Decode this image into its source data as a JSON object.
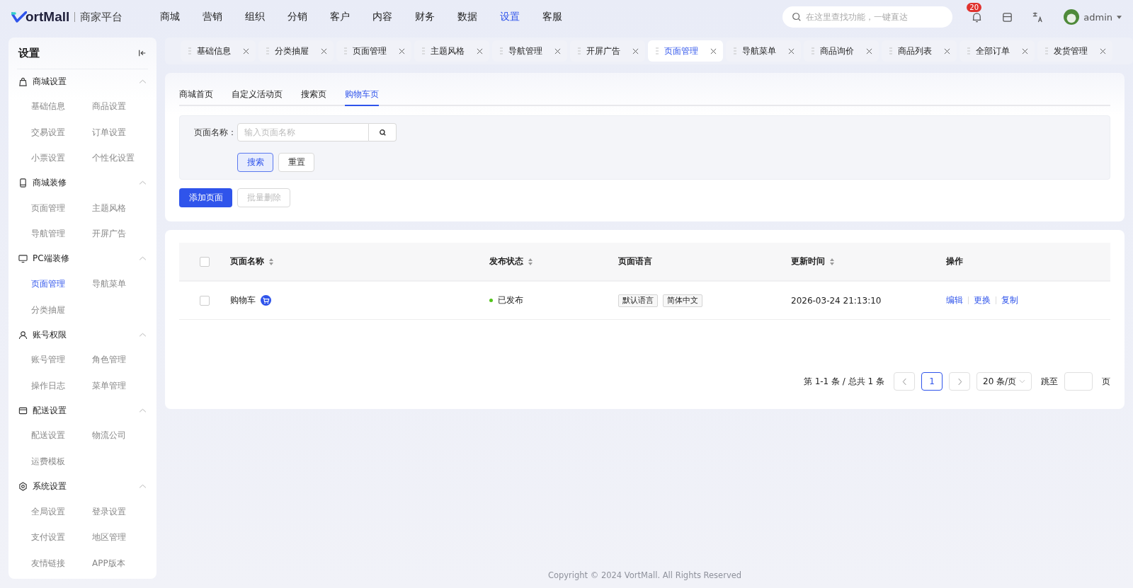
{
  "header": {
    "logo_text": "ortMall",
    "platform": "商家平台",
    "nav": [
      {
        "label": "商城",
        "selected": false
      },
      {
        "label": "营销",
        "selected": false
      },
      {
        "label": "组织",
        "selected": false
      },
      {
        "label": "分销",
        "selected": false
      },
      {
        "label": "客户",
        "selected": false
      },
      {
        "label": "内容",
        "selected": false
      },
      {
        "label": "财务",
        "selected": false
      },
      {
        "label": "数据",
        "selected": false
      },
      {
        "label": "设置",
        "selected": true
      },
      {
        "label": "客服",
        "selected": false
      }
    ],
    "search": {
      "placeholder": "在这里查找功能，一键直达"
    },
    "notification_count": "20",
    "user": "admin"
  },
  "sidebar": {
    "title": "设置",
    "groups": [
      {
        "title": "商城设置",
        "kind": "bag",
        "expanded": true,
        "items": [
          {
            "label": "基础信息",
            "selected": false
          },
          {
            "label": "商品设置",
            "selected": false
          },
          {
            "label": "交易设置",
            "selected": false
          },
          {
            "label": "订单设置",
            "selected": false
          },
          {
            "label": "小票设置",
            "selected": false
          },
          {
            "label": "个性化设置",
            "selected": false
          }
        ]
      },
      {
        "title": "商城装修",
        "kind": "phone",
        "expanded": true,
        "items": [
          {
            "label": "页面管理",
            "selected": false
          },
          {
            "label": "主题风格",
            "selected": false
          },
          {
            "label": "导航管理",
            "selected": false
          },
          {
            "label": "开屏广告",
            "selected": false
          }
        ]
      },
      {
        "title": "PC端装修",
        "kind": "monitor",
        "expanded": true,
        "items": [
          {
            "label": "页面管理",
            "selected": true
          },
          {
            "label": "导航菜单",
            "selected": false
          },
          {
            "label": "分类抽屉",
            "selected": false
          }
        ]
      },
      {
        "title": "账号权限",
        "kind": "user",
        "expanded": true,
        "items": [
          {
            "label": "账号管理",
            "selected": false
          },
          {
            "label": "角色管理",
            "selected": false
          },
          {
            "label": "操作日志",
            "selected": false
          },
          {
            "label": "菜单管理",
            "selected": false
          }
        ]
      },
      {
        "title": "配送设置",
        "kind": "wallet",
        "expanded": true,
        "items": [
          {
            "label": "配送设置",
            "selected": false
          },
          {
            "label": "物流公司",
            "selected": false
          },
          {
            "label": "运费模板",
            "selected": false
          }
        ]
      },
      {
        "title": "系统设置",
        "kind": "gear",
        "expanded": true,
        "items": [
          {
            "label": "全局设置",
            "selected": false
          },
          {
            "label": "登录设置",
            "selected": false
          },
          {
            "label": "支付设置",
            "selected": false
          },
          {
            "label": "地区管理",
            "selected": false
          },
          {
            "label": "友情链接",
            "selected": false
          },
          {
            "label": "APP版本",
            "selected": false
          }
        ]
      }
    ]
  },
  "page_tabs": [
    {
      "label": "基础信息",
      "selected": false
    },
    {
      "label": "分类抽屉",
      "selected": false
    },
    {
      "label": "页面管理",
      "selected": false
    },
    {
      "label": "主题风格",
      "selected": false
    },
    {
      "label": "导航管理",
      "selected": false
    },
    {
      "label": "开屏广告",
      "selected": false
    },
    {
      "label": "页面管理",
      "selected": true
    },
    {
      "label": "导航菜单",
      "selected": false
    },
    {
      "label": "商品询价",
      "selected": false
    },
    {
      "label": "商品列表",
      "selected": false
    },
    {
      "label": "全部订单",
      "selected": false
    },
    {
      "label": "发货管理",
      "selected": false
    }
  ],
  "sub_tabs": [
    {
      "label": "商城首页",
      "selected": false
    },
    {
      "label": "自定义活动页",
      "selected": false
    },
    {
      "label": "搜索页",
      "selected": false
    },
    {
      "label": "购物车页",
      "selected": true
    }
  ],
  "filter": {
    "label": "页面名称：",
    "placeholder": "输入页面名称",
    "search_button": "搜索",
    "reset_button": "重置"
  },
  "actions": {
    "add": "添加页面",
    "batch_delete": "批量删除",
    "batch_delete_disabled": true
  },
  "table": {
    "columns": [
      {
        "label": "页面名称",
        "sortable": true
      },
      {
        "label": "发布状态",
        "sortable": true
      },
      {
        "label": "页面语言",
        "sortable": false
      },
      {
        "label": "更新时间",
        "sortable": true
      },
      {
        "label": "操作",
        "sortable": false
      }
    ],
    "header_checked": false,
    "rows": [
      {
        "checked": false,
        "name": "购物车",
        "status": "已发布",
        "color": "#52c41a",
        "languages": [
          "默认语言",
          "简体中文"
        ],
        "updated": "2026-03-24 21:13:10",
        "operations": [
          "编辑",
          "更换",
          "复制"
        ]
      }
    ]
  },
  "pagination": {
    "summary": "第 1-1 条 / 总共 1 条",
    "pages": [
      {
        "label": "1",
        "selected": true
      }
    ],
    "page_size": "20 条/页",
    "jump_label": "跳至",
    "page_unit": "页"
  },
  "footer": "Copyright © 2024 VortMall. All Rights Reserved"
}
